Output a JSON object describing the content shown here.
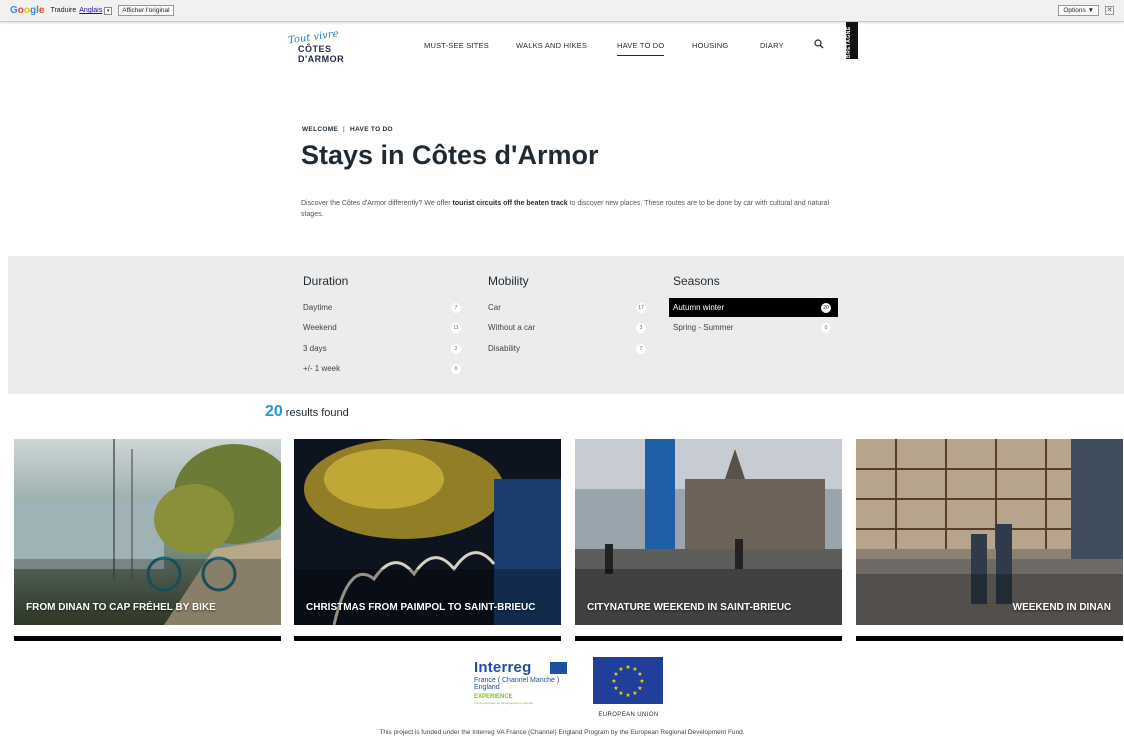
{
  "translate_bar": {
    "logo": "Google",
    "label": "Traduire",
    "language": "Anglais",
    "show_original": "Afficher l'original",
    "options": "Options ▼",
    "close": "✕"
  },
  "header": {
    "logo_script": "Tout vivre",
    "logo_brand": "CÔTES D'ARMOR",
    "nav": [
      "MUST-SEE SITES",
      "WALKS AND HIKES",
      "HAVE TO DO",
      "HOUSING",
      "DIARY"
    ],
    "active_nav": "HAVE TO DO",
    "bretagne": "BRETAGNE"
  },
  "breadcrumb": [
    "WELCOME",
    "HAVE TO DO"
  ],
  "page_title": "Stays in Côtes d'Armor",
  "intro": {
    "before": "Discover the Côtes d'Armor differently? We offer ",
    "bold": "tourist circuits off the beaten track",
    "after": " to discover new places. These routes are to be done by car with cultural and natural stages."
  },
  "filters": {
    "duration": {
      "title": "Duration",
      "items": [
        {
          "label": "Daytime",
          "count": "7"
        },
        {
          "label": "Weekend",
          "count": "11"
        },
        {
          "label": "3 days",
          "count": "2"
        },
        {
          "label": "+/- 1 week",
          "count": "0"
        }
      ]
    },
    "mobility": {
      "title": "Mobility",
      "items": [
        {
          "label": "Car",
          "count": "17"
        },
        {
          "label": "Without a car",
          "count": "3"
        },
        {
          "label": "Disability",
          "count": "7"
        }
      ]
    },
    "seasons": {
      "title": "Seasons",
      "items": [
        {
          "label": "Autumn winter",
          "count": "20",
          "selected": true
        },
        {
          "label": "Spring - Summer",
          "count": "0"
        }
      ]
    }
  },
  "results": {
    "count": "20",
    "label": "results found"
  },
  "cards": [
    {
      "title": "FROM DINAN TO CAP FRÉHEL BY BIKE"
    },
    {
      "title": "CHRISTMAS FROM PAIMPOL TO SAINT-BRIEUC"
    },
    {
      "title": "CITYNATURE WEEKEND IN SAINT-BRIEUC"
    },
    {
      "title": "WEEKEND IN DINAN"
    }
  ],
  "footer": {
    "interreg_word": "Interreg",
    "interreg_sub": "France ( Channel Manche ) England",
    "interreg_exp": "EXPERIENCE",
    "interreg_tiny": "Fonds européen de développement régional",
    "eu_label": "EUROPEAN UNION",
    "note": "This project is funded under the Interreg VA France (Channel) England Program by the European Regional Development Fund."
  }
}
